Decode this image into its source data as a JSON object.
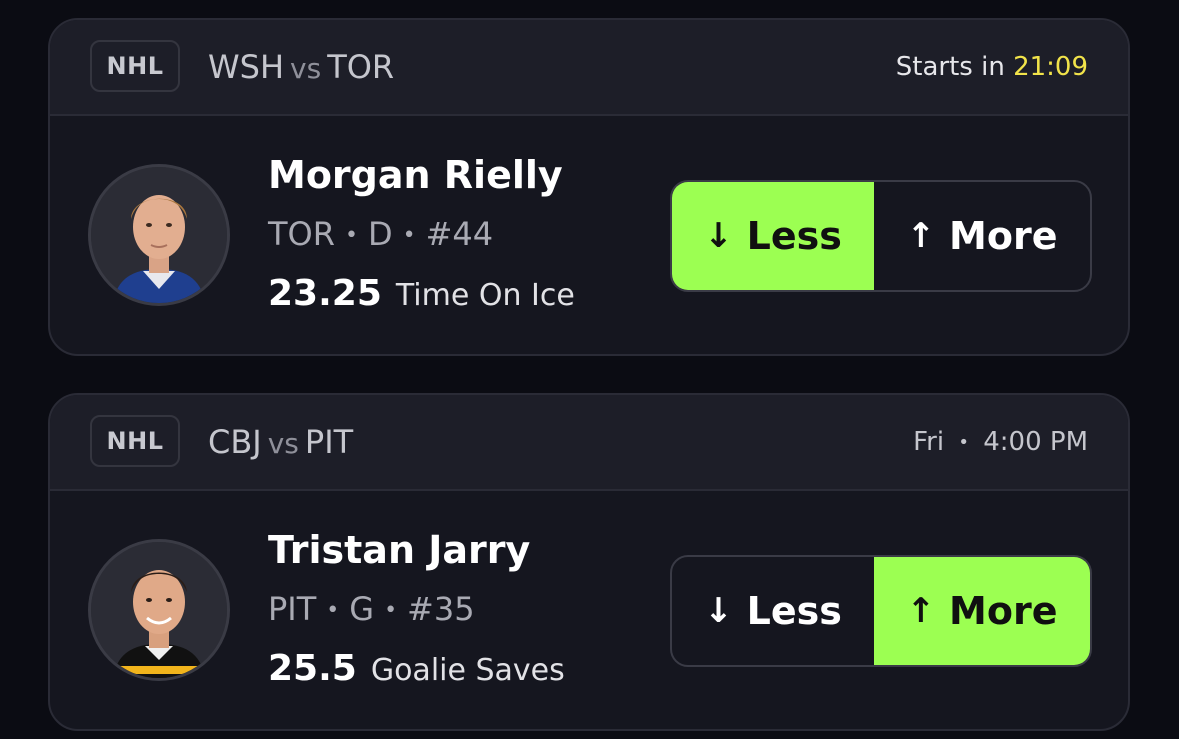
{
  "cards": [
    {
      "league": "NHL",
      "team_a": "WSH",
      "vs": "vs",
      "team_b": "TOR",
      "time_prefix": "Starts in",
      "time_value": "21:09",
      "player": {
        "name": "Morgan Rielly",
        "team": "TOR",
        "position": "D",
        "number": "#44"
      },
      "line_value": "23.25",
      "stat": "Time On Ice",
      "less_label": "Less",
      "more_label": "More",
      "selected": "less"
    },
    {
      "league": "NHL",
      "team_a": "CBJ",
      "vs": "vs",
      "team_b": "PIT",
      "time_prefix": "Fri",
      "time_value": "4:00 PM",
      "player": {
        "name": "Tristan Jarry",
        "team": "PIT",
        "position": "G",
        "number": "#35"
      },
      "line_value": "25.5",
      "stat": "Goalie Saves",
      "less_label": "Less",
      "more_label": "More",
      "selected": "more"
    }
  ],
  "separator_dot": "•",
  "icons": {
    "down": "arrow-down-icon",
    "up": "arrow-up-icon"
  },
  "colors": {
    "accent_green": "#9cff52",
    "countdown_yellow": "#f1e34a",
    "card_bg": "#15161f",
    "page_bg": "#0b0c13"
  }
}
